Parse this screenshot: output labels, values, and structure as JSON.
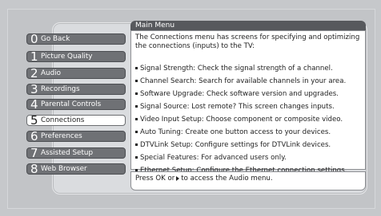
{
  "menu_title": "Main Menu",
  "menu_items": [
    {
      "num": "0",
      "label": "Go Back"
    },
    {
      "num": "1",
      "label": "Picture Quality"
    },
    {
      "num": "2",
      "label": "Audio"
    },
    {
      "num": "3",
      "label": "Recordings"
    },
    {
      "num": "4",
      "label": "Parental Controls"
    },
    {
      "num": "5",
      "label": "Connections"
    },
    {
      "num": "6",
      "label": "Preferences"
    },
    {
      "num": "7",
      "label": "Assisted Setup"
    },
    {
      "num": "8",
      "label": "Web Browser"
    }
  ],
  "selected_item": "Connections",
  "description": {
    "intro": "The Connections menu has screens for specifying and optimizing the connections (inputs) to the TV:",
    "items": [
      "Signal Strength: Check the signal strength of a channel.",
      "Channel Search: Search for available channels in your area.",
      "Software Upgrade: Check software version and upgrades.",
      "Signal Source: Lost remote? This screen changes inputs.",
      "Video Input Setup: Choose component or composite video.",
      "Auto Tuning: Create one button access to your devices.",
      "DTVLink Setup: Configure settings for DTVLink devices.",
      "Special Features: For advanced users only.",
      "Ethernet Setup: Configure the Ethernet connection settings."
    ]
  },
  "hint": {
    "before_arrow": "Press OK or",
    "after_arrow": "to access the Audio menu."
  }
}
